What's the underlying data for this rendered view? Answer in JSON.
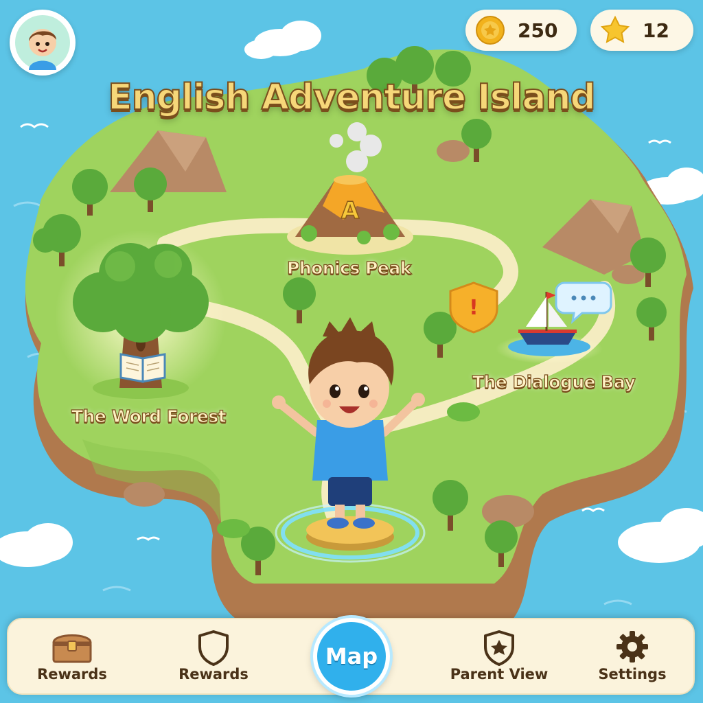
{
  "title": "English Adventure Island",
  "currency": {
    "coins": "250",
    "stars": "12"
  },
  "locations": {
    "phonics_peak": "Phonics Peak",
    "word_forest": "The Word Forest",
    "dialogue_bay": "The Dialogue Bay"
  },
  "volcano_letter": "A",
  "quest_marker": "!",
  "nav": {
    "rewards_chest": "Rewards",
    "rewards_shield": "Rewards",
    "map": "Map",
    "parent_view": "Parent View",
    "settings": "Settings"
  },
  "colors": {
    "sea": "#5cc4e6",
    "grass": "#9fd35e",
    "path": "#f4ecc0",
    "title": "#f6d779",
    "map_button": "#30b0ec"
  }
}
